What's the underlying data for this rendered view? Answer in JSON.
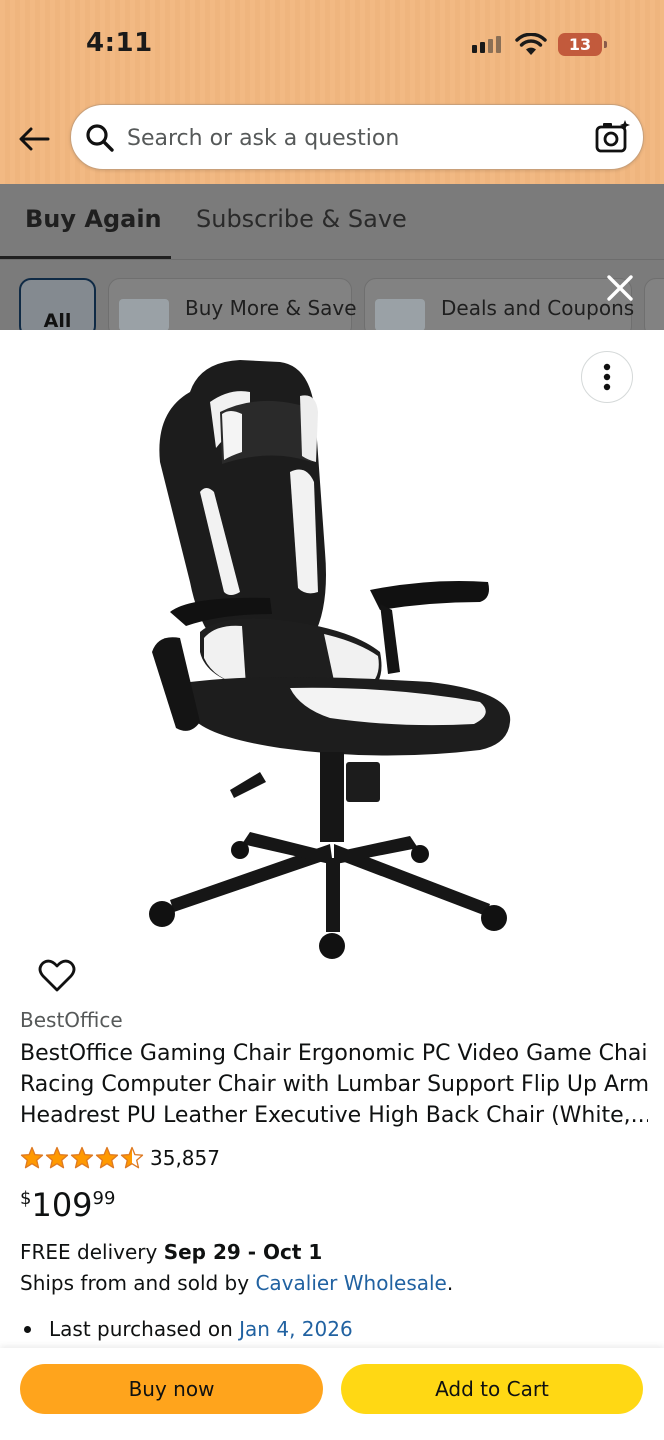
{
  "status_bar": {
    "time": "4:11",
    "battery": "13"
  },
  "header": {
    "search_placeholder": "Search or ask a question"
  },
  "tabs": [
    {
      "label": "Buy Again",
      "active": true
    },
    {
      "label": "Subscribe & Save",
      "active": false
    }
  ],
  "filters": {
    "all_label": "All",
    "chips": [
      "Buy More & Save",
      "Deals and Coupons"
    ]
  },
  "product": {
    "brand": "BestOffice",
    "title_lines": [
      "BestOffice Gaming Chair Ergonomic PC Video Game Chair",
      "Racing Computer Chair with Lumbar Support Flip Up Arms",
      "Headrest PU Leather Executive High Back Chair (White,..."
    ],
    "rating": 4.5,
    "rating_count": "35,857",
    "price": {
      "currency": "$",
      "whole": "109",
      "fraction": "99"
    },
    "delivery_prefix": "FREE delivery ",
    "delivery_dates": "Sep 29 - Oct 1",
    "ships_prefix": "Ships from and sold by ",
    "seller": "Cavalier Wholesale",
    "ships_suffix": ".",
    "last_purchased_prefix": "Last purchased on ",
    "last_purchased_date": "Jan 4, 2026"
  },
  "actions": {
    "buy_now": "Buy now",
    "add_to_cart": "Add to Cart"
  },
  "colors": {
    "header_bg": "#f2b983",
    "buy_now": "#ffa41c",
    "add_to_cart": "#ffd814",
    "star": "#ff9900",
    "link": "#2162a1"
  },
  "icons": [
    "back-arrow-icon",
    "search-icon",
    "camera-icon",
    "close-icon",
    "more-options-icon",
    "heart-icon",
    "star-icon"
  ]
}
